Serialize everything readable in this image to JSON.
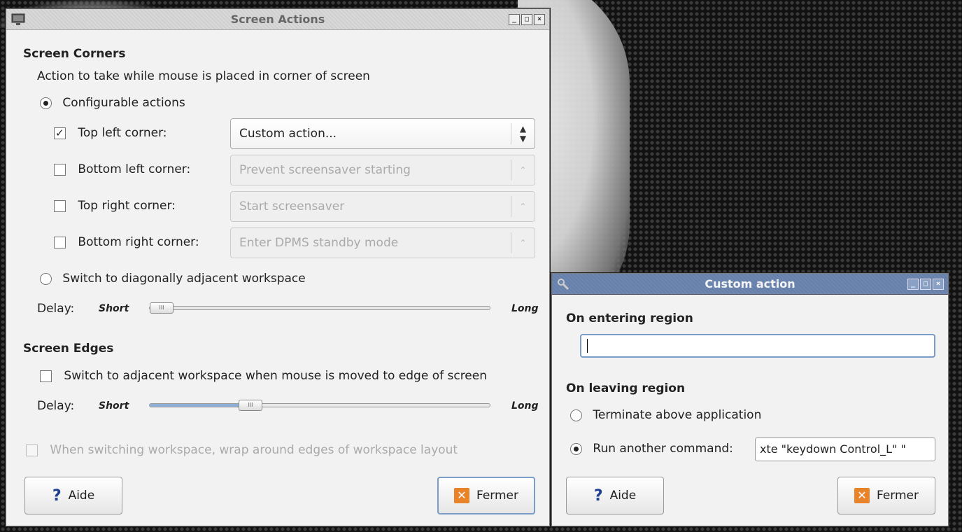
{
  "screen_actions": {
    "title": "Screen Actions",
    "corners_heading": "Screen Corners",
    "corners_desc": "Action to take while mouse is placed in corner of screen",
    "configurable_label": "Configurable actions",
    "corners": [
      {
        "label": "Top left corner:",
        "checked": true,
        "value": "Custom action...",
        "enabled": true
      },
      {
        "label": "Bottom left corner:",
        "checked": false,
        "value": "Prevent screensaver starting",
        "enabled": false
      },
      {
        "label": "Top right corner:",
        "checked": false,
        "value": "Start screensaver",
        "enabled": false
      },
      {
        "label": "Bottom right corner:",
        "checked": false,
        "value": "Enter DPMS standby mode",
        "enabled": false
      }
    ],
    "switch_diag_label": "Switch to diagonally adjacent workspace",
    "delay_label": "Delay:",
    "short_label": "Short",
    "long_label": "Long",
    "corner_delay_level": 0.0,
    "edges_heading": "Screen Edges",
    "edges_check_label": "Switch to adjacent workspace when mouse is moved to edge of screen",
    "edge_delay_level": 0.28,
    "wrap_label": "When switching workspace, wrap around edges of workspace layout",
    "help_label": "Aide",
    "close_label": "Fermer"
  },
  "custom_action": {
    "title": "Custom action",
    "entering_heading": "On entering region",
    "entering_value": "",
    "leaving_heading": "On leaving region",
    "terminate_label": "Terminate above application",
    "run_label": "Run another command:",
    "run_value": "xte \"keydown Control_L\" \"",
    "help_label": "Aide",
    "close_label": "Fermer"
  },
  "icons": {
    "window_icon": "monitor-icon",
    "custom_icon": "tools-icon",
    "help_icon": "help-icon",
    "close_icon": "close-icon"
  }
}
